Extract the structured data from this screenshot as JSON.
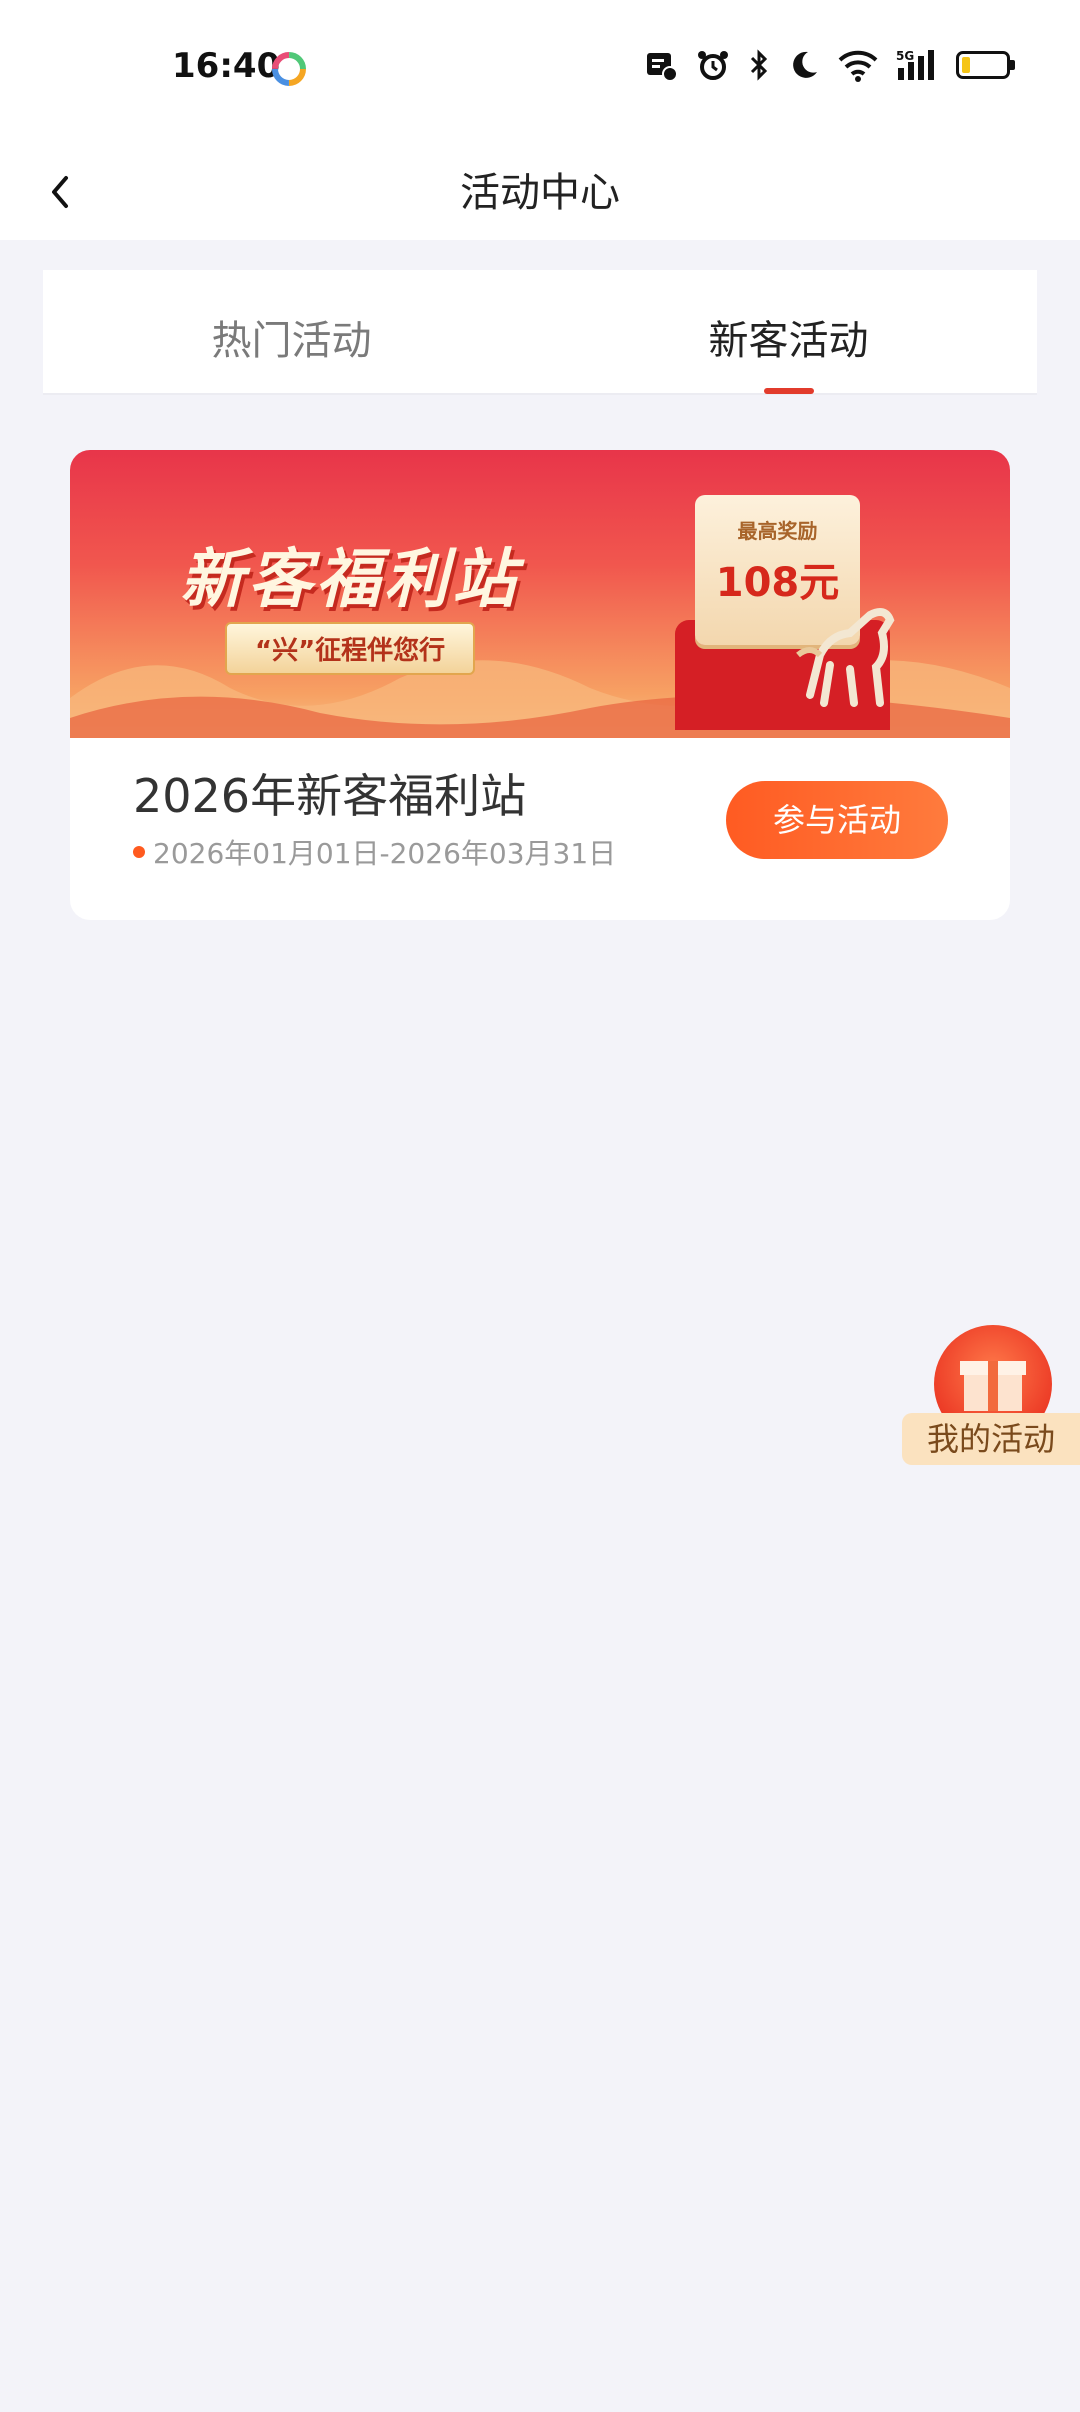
{
  "status_bar": {
    "time": "16:40",
    "network": "5G"
  },
  "nav": {
    "title": "活动中心"
  },
  "tabs": [
    {
      "label": "热门活动",
      "active": false
    },
    {
      "label": "新客活动",
      "active": true
    }
  ],
  "activity_card": {
    "banner": {
      "title": "新客福利站",
      "subtitle": "“兴”征程伴您行",
      "reward_caption": "最高奖励",
      "reward_amount": "108元"
    },
    "title": "2026年新客福利站",
    "date_range": "2026年01月01日-2026年03月31日",
    "join_label": "参与活动"
  },
  "floating_button": {
    "label": "我的活动"
  },
  "colors": {
    "accent": "#e23b2c",
    "button": "#ff5b22",
    "background": "#f3f3f9"
  }
}
